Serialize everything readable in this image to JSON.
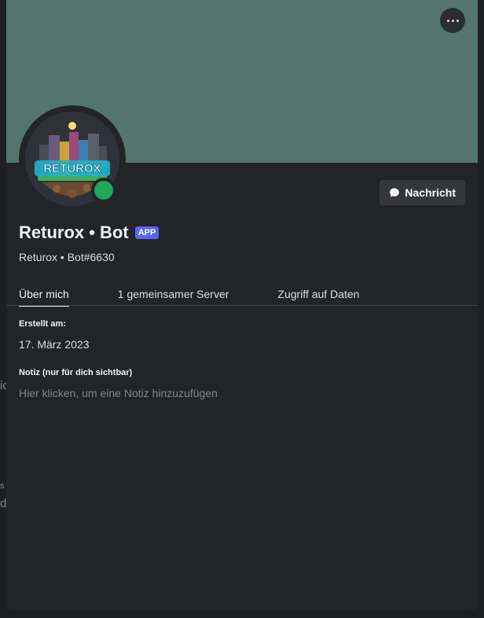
{
  "banner": {
    "color": "#52756c"
  },
  "profile": {
    "display_name": "Returox • Bot",
    "badge": "APP",
    "username": "Returox • Bot#6630",
    "status": "online",
    "status_color": "#23a55a"
  },
  "actions": {
    "message_label": "Nachricht",
    "more_icon": "more-horizontal-icon"
  },
  "tabs": [
    {
      "label": "Über mich",
      "active": true
    },
    {
      "label": "1 gemeinsamer Server",
      "active": false
    },
    {
      "label": "Zugriff auf Daten",
      "active": false
    }
  ],
  "about": {
    "created_title": "Erstellt am:",
    "created_value": "17. März 2023",
    "note_title": "Notiz (nur für dich sichtbar)",
    "note_placeholder": "Hier klicken, um eine Notiz hinzuzufügen"
  },
  "background": {
    "fragment_1": "ic",
    "fragment_2": "s",
    "fragment_3": "de"
  }
}
